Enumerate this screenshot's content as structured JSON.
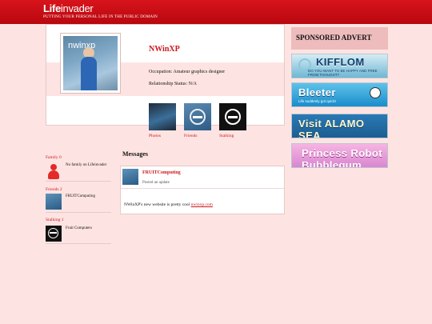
{
  "header": {
    "brand_prefix": "Life",
    "brand_suffix": "invader",
    "tagline": "PUTTING YOUR PERSONAL LIFE IN THE PUBLIC DOMAIN"
  },
  "profile": {
    "name": "NWinXP",
    "avatar_text": "nwinxp",
    "occupation_label": "Occupation: Amateur graphics designer",
    "relationship_label": "Relationship Status: N/A"
  },
  "profile_tiles": [
    {
      "label": "Photos"
    },
    {
      "label": "Friends"
    },
    {
      "label": "Stalking"
    }
  ],
  "sponsored": {
    "title": "SPONSORED ADVERT",
    "ads": [
      {
        "main": "KIFFLOM",
        "sub": "DO YOU WANT TO BE HAPPY AND FREE FROM THOUGHT?"
      },
      {
        "main": "Bleeter",
        "sub": "Life suddenly got quick!"
      },
      {
        "main": "Visit ALAMO SEA",
        "sub": ""
      },
      {
        "main": "Princess Robot Bubblegum",
        "sub": ""
      }
    ]
  },
  "sidebar": {
    "family": {
      "title": "Family 0",
      "text": "No family on Lifeinvader"
    },
    "friends": {
      "title": "Friends 2",
      "text": "FRUITComputing"
    },
    "stalking": {
      "title": "Stalking 1",
      "text": "Fruit Computers"
    }
  },
  "messages": {
    "title": "Messages",
    "author": "FRUITComputing",
    "action": "Posted an update",
    "text_prefix": "NWinXP's new website is pretty cool ",
    "link": "nwinxp.com"
  },
  "colors": {
    "brand_red": "#cc1720",
    "background": "#fde4e2"
  }
}
